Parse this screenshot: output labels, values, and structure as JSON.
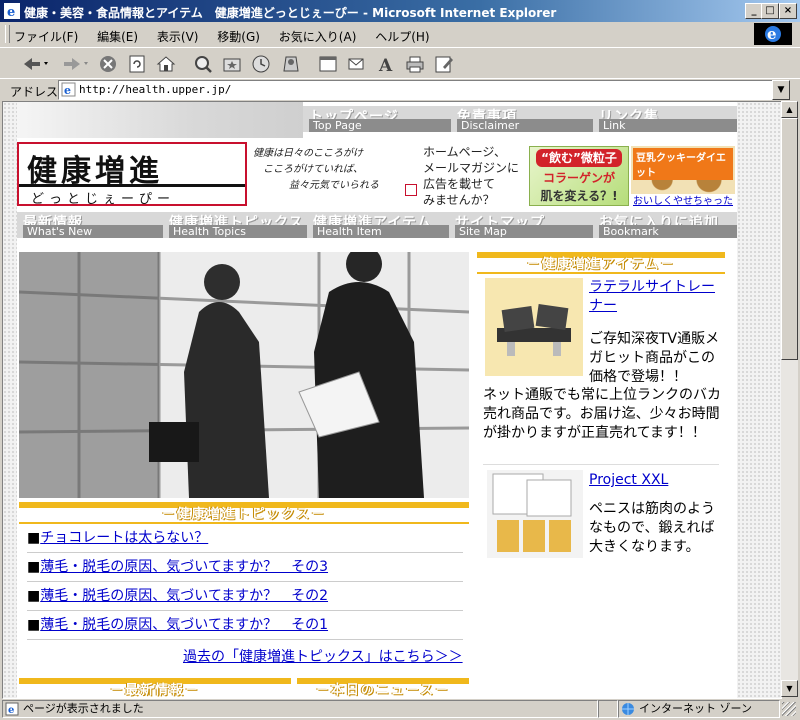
{
  "window": {
    "title": "健康・美容・食品情報とアイテム　健康増進どっとじぇーぴー - Microsoft Internet Explorer",
    "buttons": {
      "min": "_",
      "max": "□",
      "close": "×"
    }
  },
  "menu": [
    "ファイル(F)",
    "編集(E)",
    "表示(V)",
    "移動(G)",
    "お気に入り(A)",
    "ヘルプ(H)"
  ],
  "address": {
    "label": "アドレス",
    "url": "http://health.upper.jp/"
  },
  "status": {
    "text": "ページが表示されました",
    "zone": "インターネット ゾーン"
  },
  "page": {
    "topnav": [
      {
        "jp": "トップページ",
        "en": "Top Page"
      },
      {
        "jp": "免責事項",
        "en": "Disclaimer"
      },
      {
        "jp": "リンク集",
        "en": "Link"
      }
    ],
    "logo": {
      "line1": "健康増進",
      "line2": "どっとじぇーぴー"
    },
    "tagline": [
      "健康は日々のこころがけ",
      "こころがけていれば、",
      "益々元気でいられる"
    ],
    "ad_text": [
      "ホームページ、",
      "メールマガジンに",
      "広告を載せて",
      "みませんか？"
    ],
    "banner1": [
      "“飲む”微粒子",
      "コラーゲンが",
      "肌を変える？!"
    ],
    "banner2": {
      "title": "豆乳クッキーダイエット",
      "link": "おいしくやせちゃった"
    },
    "mainnav": [
      {
        "jp": "最新情報",
        "en": "What's New"
      },
      {
        "jp": "健康増進トピックス",
        "en": "Health Topics"
      },
      {
        "jp": "健康増進アイテム",
        "en": "Health Item"
      },
      {
        "jp": "サイトマップ",
        "en": "Site Map"
      },
      {
        "jp": "お気に入りに追加",
        "en": "Bookmark"
      }
    ],
    "topics_header": "－健康増進トピックス－",
    "topics": [
      "チョコレートは太らない？",
      "薄毛・脱毛の原因、気づいてますか？　その3",
      "薄毛・脱毛の原因、気づいてますか？　その2",
      "薄毛・脱毛の原因、気づいてますか？　その1"
    ],
    "topics_more": "過去の「健康増進トピックス」はこちら＞＞",
    "news_header": "－最新情報－",
    "today_header": "－本日のニュース－",
    "items_header": "－健康増進アイテム－",
    "items": [
      {
        "name": "ラテラルサイトレーナー",
        "desc1": "ご存知深夜TV通販メガヒット商品がこの価格で登場！！",
        "desc2": "ネット通販でも常に上位ランクのバカ売れ商品です。お届け迄、少々お時間が掛かりますが正直売れてます！！"
      },
      {
        "name": "Project XXL",
        "desc1": "ペニスは筋肉のようなもので、鍛えれば大きくなります。"
      }
    ]
  },
  "colors": {
    "accent": "#f0b81c",
    "logo_red": "#c8102e",
    "link": "#0000cc"
  }
}
